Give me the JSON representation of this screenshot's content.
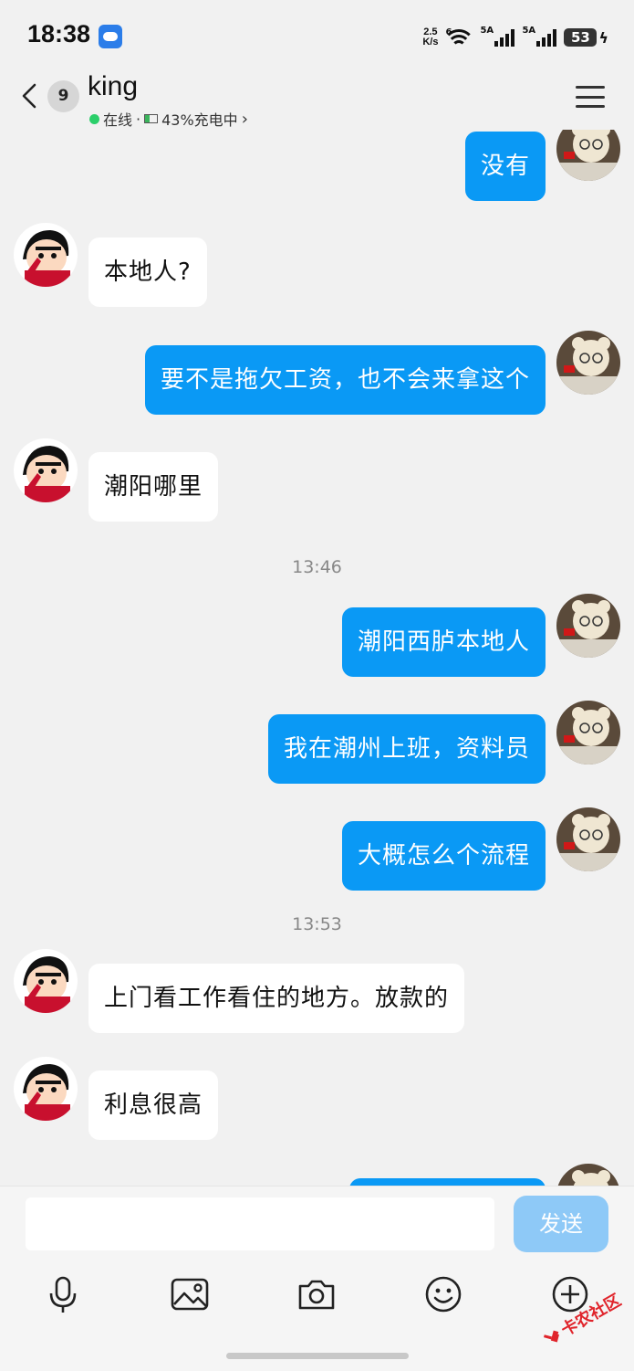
{
  "status_bar": {
    "time": "18:38",
    "net_speed_value": "2.5",
    "net_speed_unit": "K/s",
    "wifi_label": "6",
    "signal1_label": "5A",
    "signal2_label": "5A",
    "battery_level": "53"
  },
  "header": {
    "unread_count": "9",
    "contact_name": "king",
    "online_status": "在线",
    "separator": "·",
    "battery_status": "43%充电中"
  },
  "messages": [
    {
      "side": "out",
      "text": "没有"
    },
    {
      "side": "in",
      "text": "本地人?"
    },
    {
      "side": "out",
      "text": "要不是拖欠工资，也不会来拿这个"
    },
    {
      "side": "in",
      "text": "潮阳哪里"
    },
    {
      "side": "time",
      "text": "13:46"
    },
    {
      "side": "out",
      "text": "潮阳西胪本地人"
    },
    {
      "side": "out",
      "text": "我在潮州上班，资料员"
    },
    {
      "side": "out",
      "text": "大概怎么个流程"
    },
    {
      "side": "time",
      "text": "13:53"
    },
    {
      "side": "in",
      "text": "上门看工作看住的地方。放款的"
    },
    {
      "side": "in",
      "text": "利息很高"
    }
  ],
  "input": {
    "value": "",
    "send_label": "发送"
  },
  "toolbar_icons": [
    "microphone-icon",
    "image-icon",
    "camera-icon",
    "emoji-icon",
    "plus-icon"
  ],
  "watermark": {
    "text": "卡农社区"
  },
  "colors": {
    "outgoing_bubble": "#0a99f5",
    "incoming_bubble": "#ffffff",
    "background": "#f1f1f1",
    "send_button": "#8ec9f7",
    "online_dot": "#2bcf6a"
  }
}
